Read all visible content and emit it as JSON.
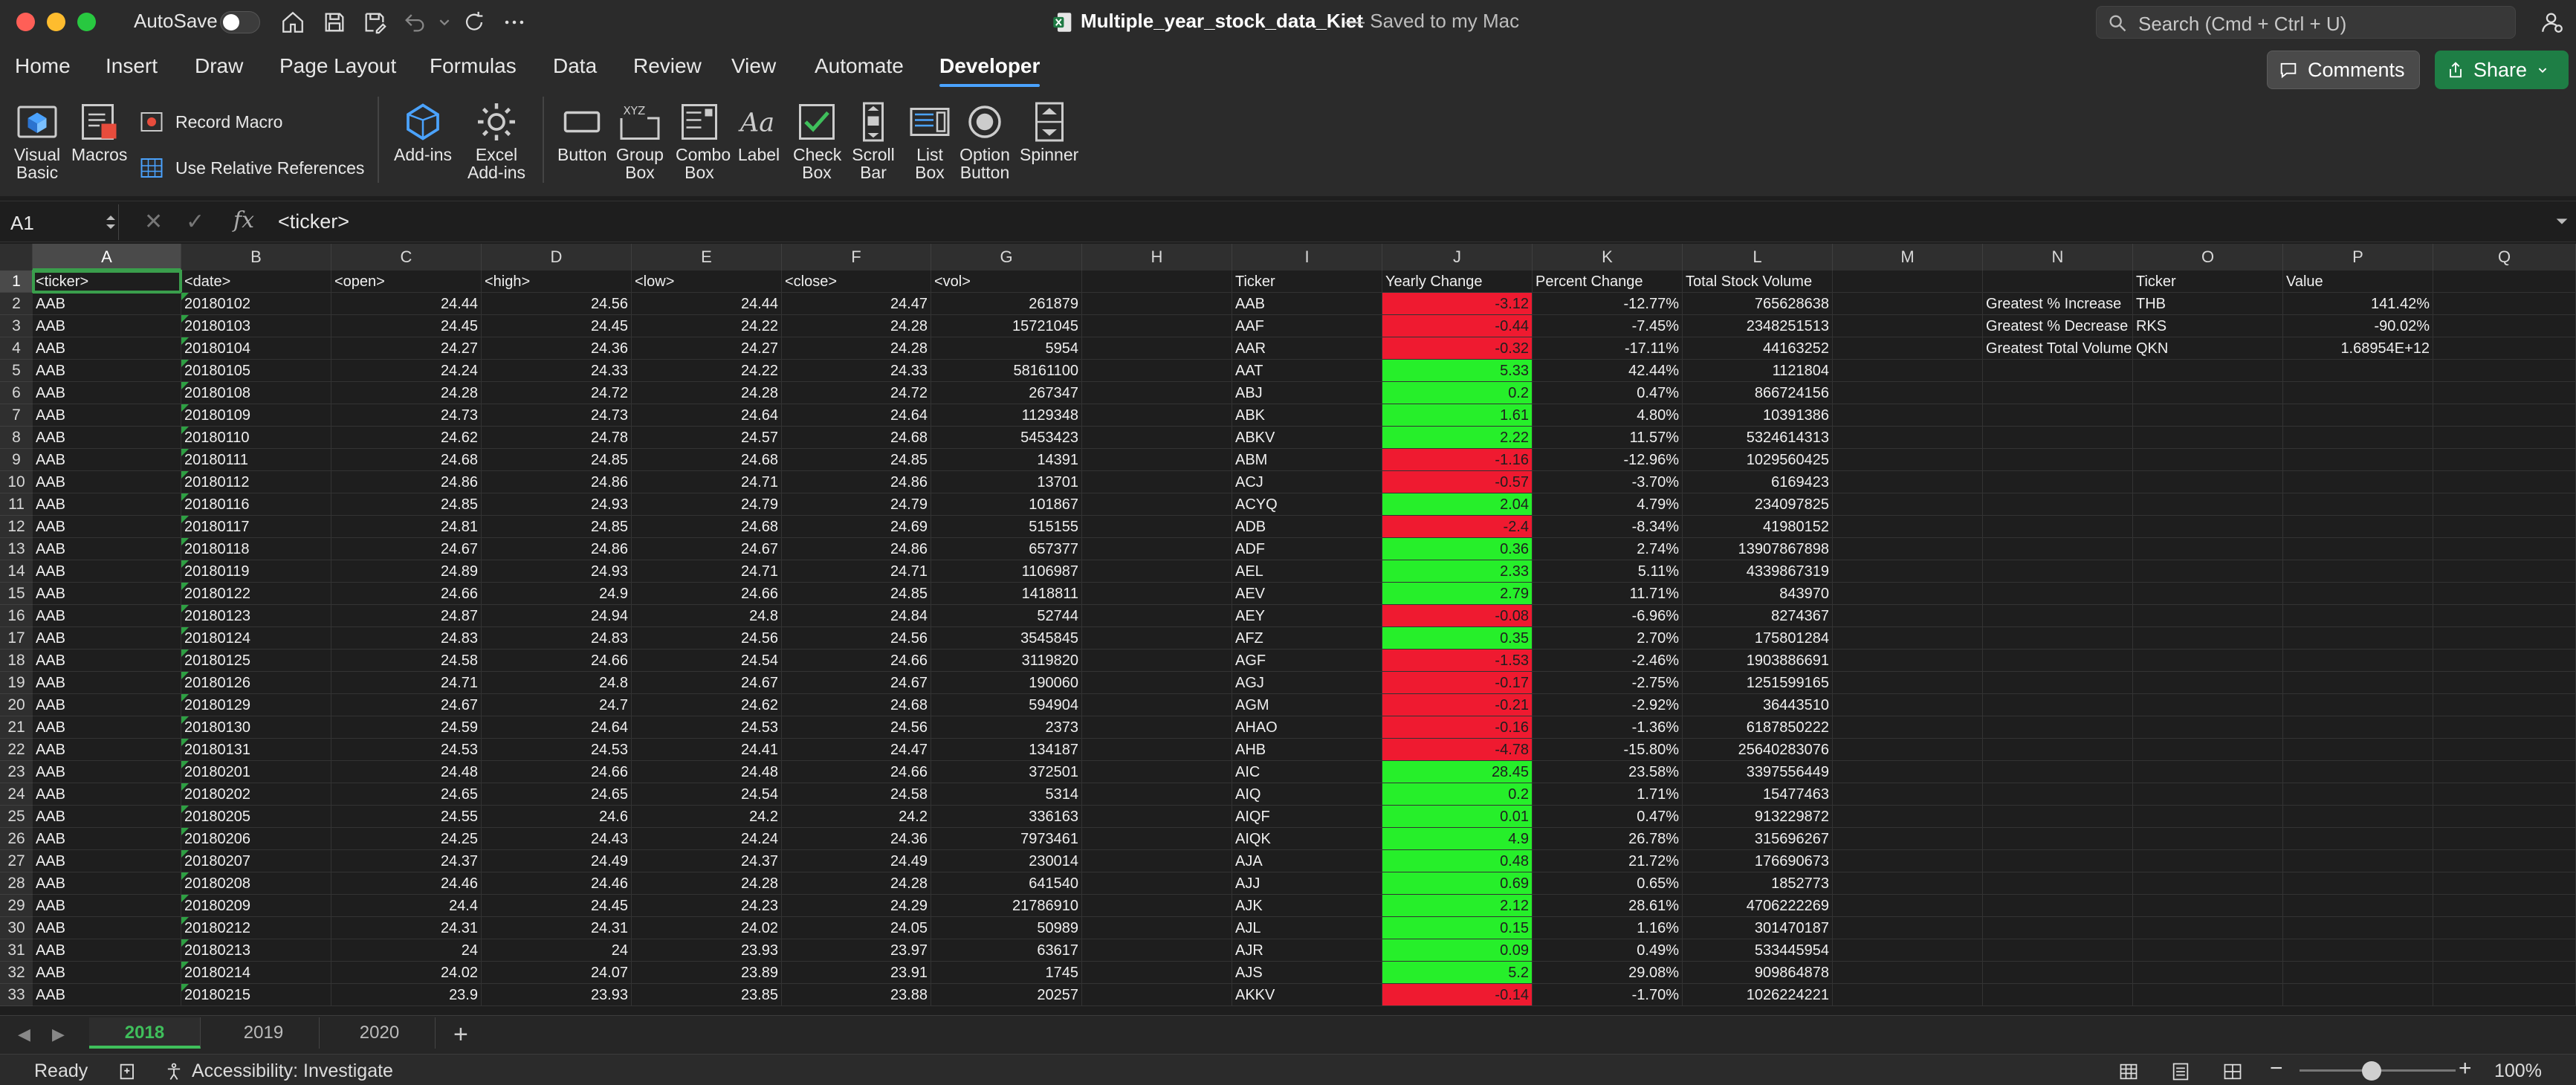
{
  "window": {
    "autosave_label": "AutoSave",
    "doc_title": "Multiple_year_stock_data_Kiet",
    "doc_status": "— Saved to my Mac",
    "search_placeholder": "Search (Cmd + Ctrl + U)",
    "light_colors": [
      "#ff5f57",
      "#febc2e",
      "#28c840"
    ]
  },
  "ribbon": {
    "tabs": [
      "Home",
      "Insert",
      "Draw",
      "Page Layout",
      "Formulas",
      "Data",
      "Review",
      "View",
      "Automate",
      "Developer"
    ],
    "active_tab": "Developer",
    "comments_label": "Comments",
    "share_label": "Share",
    "tools": {
      "visual_basic": "Visual Basic",
      "macros": "Macros",
      "record_macro": "Record Macro",
      "use_relative_references": "Use Relative References",
      "add_ins": "Add-ins",
      "excel_add_ins": "Excel Add-ins",
      "button": "Button",
      "group_box": "Group Box",
      "combo_box": "Combo Box",
      "label": "Label",
      "check_box": "Check Box",
      "scroll_bar": "Scroll Bar",
      "list_box": "List Box",
      "option_button": "Option Button",
      "spinner": "Spinner"
    }
  },
  "formula_bar": {
    "name_box": "A1",
    "fx": "fx",
    "formula": "<ticker>"
  },
  "grid": {
    "columns": [
      "A",
      "B",
      "C",
      "D",
      "E",
      "F",
      "G",
      "H",
      "I",
      "J",
      "K",
      "L",
      "M",
      "N",
      "O",
      "P",
      "Q"
    ],
    "selected_column": "A",
    "selected_row": 1,
    "header_row": [
      "<ticker>",
      "<date>",
      "<open>",
      "<high>",
      "<low>",
      "<close>",
      "<vol>",
      "",
      "Ticker",
      "Yearly Change",
      "Percent Change",
      "Total Stock Volume",
      "",
      "",
      "Ticker",
      "Value",
      ""
    ],
    "rows": [
      [
        "AAB",
        "20180102",
        "24.44",
        "24.56",
        "24.44",
        "24.47",
        "261879",
        "",
        "AAB",
        "-3.12",
        "-12.77%",
        "765628638",
        "",
        "Greatest % Increase",
        "THB",
        "141.42%",
        ""
      ],
      [
        "AAB",
        "20180103",
        "24.45",
        "24.45",
        "24.22",
        "24.28",
        "15721045",
        "",
        "AAF",
        "-0.44",
        "-7.45%",
        "2348251513",
        "",
        "Greatest % Decrease",
        "RKS",
        "-90.02%",
        ""
      ],
      [
        "AAB",
        "20180104",
        "24.27",
        "24.36",
        "24.27",
        "24.28",
        "5954",
        "",
        "AAR",
        "-0.32",
        "-17.11%",
        "44163252",
        "",
        "Greatest Total Volume",
        "QKN",
        "1.68954E+12",
        ""
      ],
      [
        "AAB",
        "20180105",
        "24.24",
        "24.33",
        "24.22",
        "24.33",
        "58161100",
        "",
        "AAT",
        "5.33",
        "42.44%",
        "1121804",
        "",
        "",
        "",
        "",
        ""
      ],
      [
        "AAB",
        "20180108",
        "24.28",
        "24.72",
        "24.28",
        "24.72",
        "267347",
        "",
        "ABJ",
        "0.2",
        "0.47%",
        "866724156",
        "",
        "",
        "",
        "",
        ""
      ],
      [
        "AAB",
        "20180109",
        "24.73",
        "24.73",
        "24.64",
        "24.64",
        "1129348",
        "",
        "ABK",
        "1.61",
        "4.80%",
        "10391386",
        "",
        "",
        "",
        "",
        ""
      ],
      [
        "AAB",
        "20180110",
        "24.62",
        "24.78",
        "24.57",
        "24.68",
        "5453423",
        "",
        "ABKV",
        "2.22",
        "11.57%",
        "5324614313",
        "",
        "",
        "",
        "",
        ""
      ],
      [
        "AAB",
        "20180111",
        "24.68",
        "24.85",
        "24.68",
        "24.85",
        "14391",
        "",
        "ABM",
        "-1.16",
        "-12.96%",
        "1029560425",
        "",
        "",
        "",
        "",
        ""
      ],
      [
        "AAB",
        "20180112",
        "24.86",
        "24.86",
        "24.71",
        "24.86",
        "13701",
        "",
        "ACJ",
        "-0.57",
        "-3.70%",
        "6169423",
        "",
        "",
        "",
        "",
        ""
      ],
      [
        "AAB",
        "20180116",
        "24.85",
        "24.93",
        "24.79",
        "24.79",
        "101867",
        "",
        "ACYQ",
        "2.04",
        "4.79%",
        "234097825",
        "",
        "",
        "",
        "",
        ""
      ],
      [
        "AAB",
        "20180117",
        "24.81",
        "24.85",
        "24.68",
        "24.69",
        "515155",
        "",
        "ADB",
        "-2.4",
        "-8.34%",
        "41980152",
        "",
        "",
        "",
        "",
        ""
      ],
      [
        "AAB",
        "20180118",
        "24.67",
        "24.86",
        "24.67",
        "24.86",
        "657377",
        "",
        "ADF",
        "0.36",
        "2.74%",
        "13907867898",
        "",
        "",
        "",
        "",
        ""
      ],
      [
        "AAB",
        "20180119",
        "24.89",
        "24.93",
        "24.71",
        "24.71",
        "1106987",
        "",
        "AEL",
        "2.33",
        "5.11%",
        "4339867319",
        "",
        "",
        "",
        "",
        ""
      ],
      [
        "AAB",
        "20180122",
        "24.66",
        "24.9",
        "24.66",
        "24.85",
        "1418811",
        "",
        "AEV",
        "2.79",
        "11.71%",
        "843970",
        "",
        "",
        "",
        "",
        ""
      ],
      [
        "AAB",
        "20180123",
        "24.87",
        "24.94",
        "24.8",
        "24.84",
        "52744",
        "",
        "AEY",
        "-0.08",
        "-6.96%",
        "8274367",
        "",
        "",
        "",
        "",
        ""
      ],
      [
        "AAB",
        "20180124",
        "24.83",
        "24.83",
        "24.56",
        "24.56",
        "3545845",
        "",
        "AFZ",
        "0.35",
        "2.70%",
        "175801284",
        "",
        "",
        "",
        "",
        ""
      ],
      [
        "AAB",
        "20180125",
        "24.58",
        "24.66",
        "24.54",
        "24.66",
        "3119820",
        "",
        "AGF",
        "-1.53",
        "-2.46%",
        "1903886691",
        "",
        "",
        "",
        "",
        ""
      ],
      [
        "AAB",
        "20180126",
        "24.71",
        "24.8",
        "24.67",
        "24.67",
        "190060",
        "",
        "AGJ",
        "-0.17",
        "-2.75%",
        "1251599165",
        "",
        "",
        "",
        "",
        ""
      ],
      [
        "AAB",
        "20180129",
        "24.67",
        "24.7",
        "24.62",
        "24.68",
        "594904",
        "",
        "AGM",
        "-0.21",
        "-2.92%",
        "36443510",
        "",
        "",
        "",
        "",
        ""
      ],
      [
        "AAB",
        "20180130",
        "24.59",
        "24.64",
        "24.53",
        "24.56",
        "2373",
        "",
        "AHAO",
        "-0.16",
        "-1.36%",
        "6187850222",
        "",
        "",
        "",
        "",
        ""
      ],
      [
        "AAB",
        "20180131",
        "24.53",
        "24.53",
        "24.41",
        "24.47",
        "134187",
        "",
        "AHB",
        "-4.78",
        "-15.80%",
        "25640283076",
        "",
        "",
        "",
        "",
        ""
      ],
      [
        "AAB",
        "20180201",
        "24.48",
        "24.66",
        "24.48",
        "24.66",
        "372501",
        "",
        "AIC",
        "28.45",
        "23.58%",
        "3397556449",
        "",
        "",
        "",
        "",
        ""
      ],
      [
        "AAB",
        "20180202",
        "24.65",
        "24.65",
        "24.54",
        "24.58",
        "5314",
        "",
        "AIQ",
        "0.2",
        "1.71%",
        "15477463",
        "",
        "",
        "",
        "",
        ""
      ],
      [
        "AAB",
        "20180205",
        "24.55",
        "24.6",
        "24.2",
        "24.2",
        "336163",
        "",
        "AIQF",
        "0.01",
        "0.47%",
        "913229872",
        "",
        "",
        "",
        "",
        ""
      ],
      [
        "AAB",
        "20180206",
        "24.25",
        "24.43",
        "24.24",
        "24.36",
        "7973461",
        "",
        "AIQK",
        "4.9",
        "26.78%",
        "315696267",
        "",
        "",
        "",
        "",
        ""
      ],
      [
        "AAB",
        "20180207",
        "24.37",
        "24.49",
        "24.37",
        "24.49",
        "230014",
        "",
        "AJA",
        "0.48",
        "21.72%",
        "176690673",
        "",
        "",
        "",
        "",
        ""
      ],
      [
        "AAB",
        "20180208",
        "24.46",
        "24.46",
        "24.28",
        "24.28",
        "641540",
        "",
        "AJJ",
        "0.69",
        "0.65%",
        "1852773",
        "",
        "",
        "",
        "",
        ""
      ],
      [
        "AAB",
        "20180209",
        "24.4",
        "24.45",
        "24.23",
        "24.29",
        "21786910",
        "",
        "AJK",
        "2.12",
        "28.61%",
        "4706222269",
        "",
        "",
        "",
        "",
        ""
      ],
      [
        "AAB",
        "20180212",
        "24.31",
        "24.31",
        "24.02",
        "24.05",
        "50989",
        "",
        "AJL",
        "0.15",
        "1.16%",
        "301470187",
        "",
        "",
        "",
        "",
        ""
      ],
      [
        "AAB",
        "20180213",
        "24",
        "24",
        "23.93",
        "23.97",
        "63617",
        "",
        "AJR",
        "0.09",
        "0.49%",
        "533445954",
        "",
        "",
        "",
        "",
        ""
      ],
      [
        "AAB",
        "20180214",
        "24.02",
        "24.07",
        "23.89",
        "23.91",
        "1745",
        "",
        "AJS",
        "5.2",
        "29.08%",
        "909864878",
        "",
        "",
        "",
        "",
        ""
      ],
      [
        "AAB",
        "20180215",
        "23.9",
        "23.93",
        "23.85",
        "23.88",
        "20257",
        "",
        "AKKV",
        "-0.14",
        "-1.70%",
        "1026224221",
        "",
        "",
        "",
        "",
        ""
      ]
    ],
    "positive_fill": "#26ef2a",
    "negative_fill": "#ef1a30"
  },
  "sheets": {
    "tabs": [
      "2018",
      "2019",
      "2020"
    ],
    "active": "2018",
    "add_label": "+"
  },
  "status_bar": {
    "ready": "Ready",
    "accessibility": "Accessibility: Investigate",
    "zoom": "100%",
    "zoom_fraction": 0.5
  }
}
